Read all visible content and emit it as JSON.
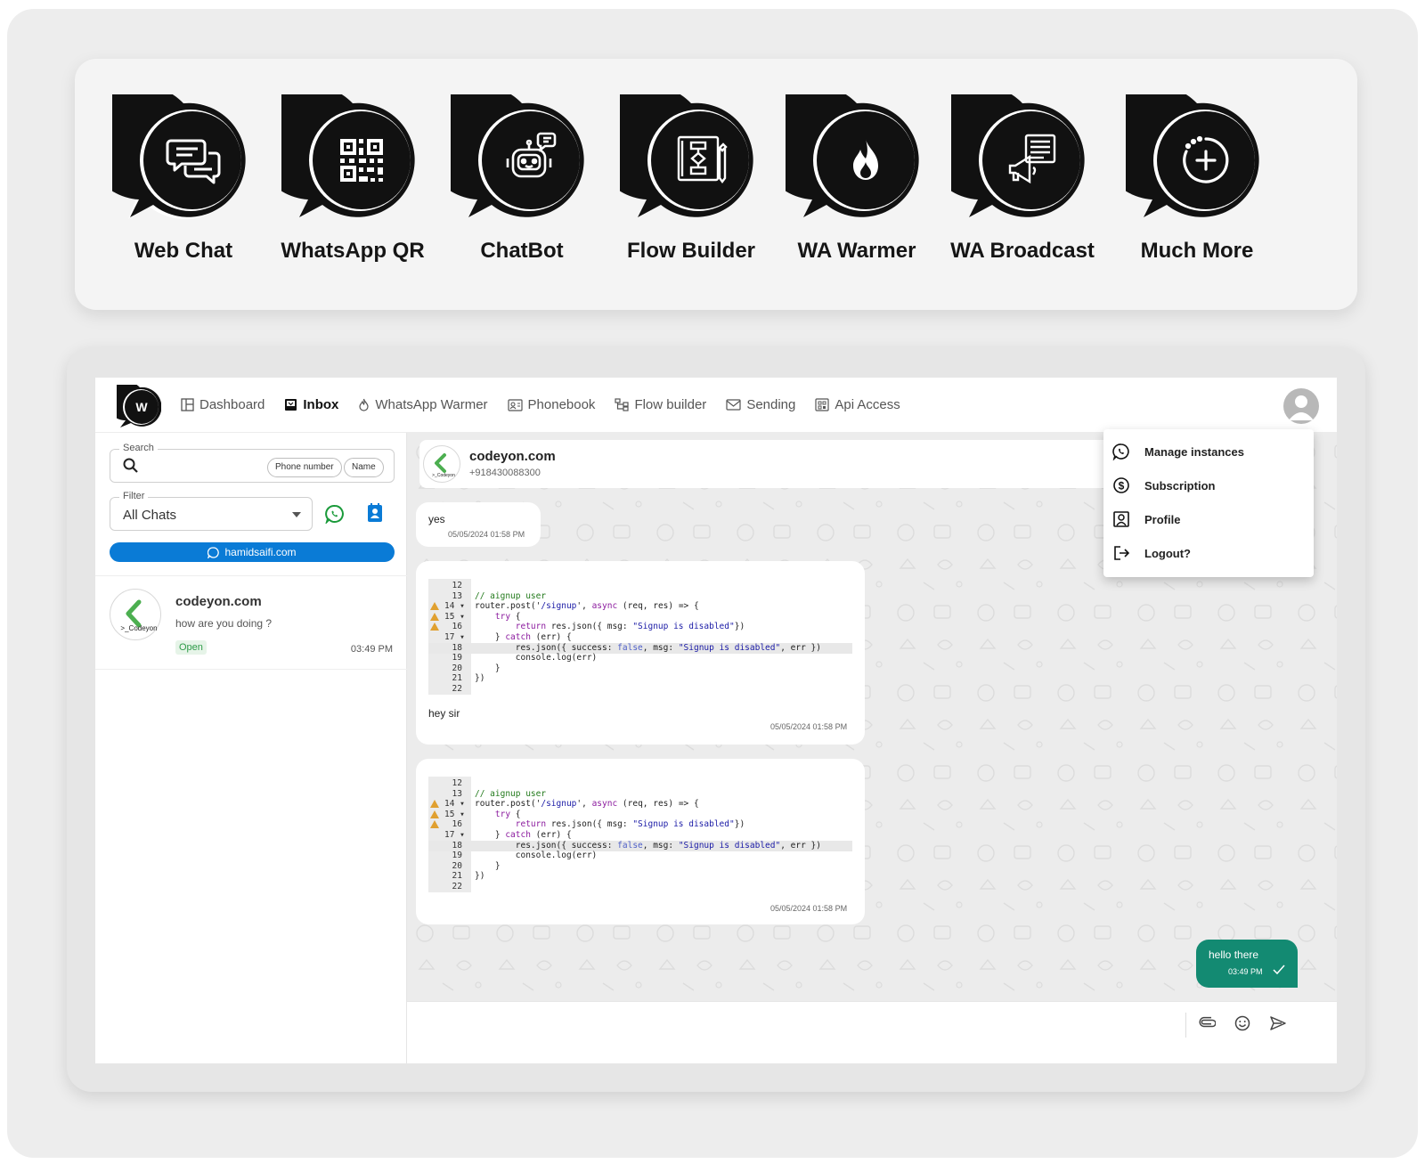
{
  "features": [
    {
      "label": "Web Chat",
      "icon": "chat-bubbles-icon"
    },
    {
      "label": "WhatsApp QR",
      "icon": "qr-code-icon"
    },
    {
      "label": "ChatBot",
      "icon": "robot-icon"
    },
    {
      "label": "Flow Builder",
      "icon": "flowchart-icon"
    },
    {
      "label": "WA Warmer",
      "icon": "flame-icon"
    },
    {
      "label": "WA Broadcast",
      "icon": "megaphone-icon"
    },
    {
      "label": "Much More",
      "icon": "plus-circle-icon"
    }
  ],
  "app": {
    "logo_text": "W",
    "nav": [
      {
        "label": "Dashboard",
        "icon": "dashboard-icon",
        "active": false
      },
      {
        "label": "Inbox",
        "icon": "inbox-icon",
        "active": true
      },
      {
        "label": "WhatsApp Warmer",
        "icon": "flame-icon",
        "active": false
      },
      {
        "label": "Phonebook",
        "icon": "phonebook-icon",
        "active": false
      },
      {
        "label": "Flow builder",
        "icon": "flow-icon",
        "active": false
      },
      {
        "label": "Sending",
        "icon": "mail-icon",
        "active": false
      },
      {
        "label": "Api Access",
        "icon": "api-icon",
        "active": false
      }
    ],
    "sidebar": {
      "search_label": "Search",
      "chip_phone": "Phone number",
      "chip_name": "Name",
      "filter_label": "Filter",
      "filter_value": "All Chats",
      "instance": "hamidsaifi.com",
      "conversation": {
        "name": "codeyon.com",
        "preview": "how are you doing ?",
        "status": "Open",
        "time": "03:49 PM",
        "avatar_text": ">_Codeyon"
      }
    },
    "chat": {
      "contact_name": "codeyon.com",
      "contact_phone": "+918430088300",
      "messages": [
        {
          "text": "yes",
          "time": "05/05/2024 01:58 PM"
        },
        {
          "text": "hey sir",
          "time": "05/05/2024 01:58 PM"
        },
        {
          "text": "",
          "time": "05/05/2024 01:58 PM"
        }
      ],
      "outgoing": {
        "text": "hello there",
        "time": "03:49 PM"
      }
    },
    "code_lines": [
      {
        "n": "12",
        "t": "",
        "warn": false,
        "hl": false
      },
      {
        "n": "13",
        "t": "// aignup user",
        "warn": false,
        "hl": false
      },
      {
        "n": "14 ▾",
        "t": "router.post('/signup', async (req, res) => {",
        "warn": true,
        "hl": false
      },
      {
        "n": "15 ▾",
        "t": "    try {",
        "warn": true,
        "hl": false
      },
      {
        "n": "16",
        "t": "        return res.json({ msg: \"Signup is disabled\"})",
        "warn": true,
        "hl": false
      },
      {
        "n": "17 ▾",
        "t": "    } catch (err) {",
        "warn": false,
        "hl": false
      },
      {
        "n": "18",
        "t": "        res.json({ success: false, msg: \"Signup is disabled\", err })",
        "warn": false,
        "hl": true
      },
      {
        "n": "19",
        "t": "        console.log(err)",
        "warn": false,
        "hl": false
      },
      {
        "n": "20",
        "t": "    }",
        "warn": false,
        "hl": false
      },
      {
        "n": "21",
        "t": "})",
        "warn": false,
        "hl": false
      },
      {
        "n": "22",
        "t": "",
        "warn": false,
        "hl": false
      }
    ],
    "menu": [
      {
        "label": "Manage instances",
        "icon": "whatsapp-icon"
      },
      {
        "label": "Subscription",
        "icon": "dollar-icon"
      },
      {
        "label": "Profile",
        "icon": "profile-icon"
      },
      {
        "label": "Logout?",
        "icon": "logout-icon"
      }
    ],
    "colors": {
      "accent_blue": "#0a7bd6",
      "accent_green": "#138a72",
      "open_badge": "#2e9b48"
    }
  }
}
